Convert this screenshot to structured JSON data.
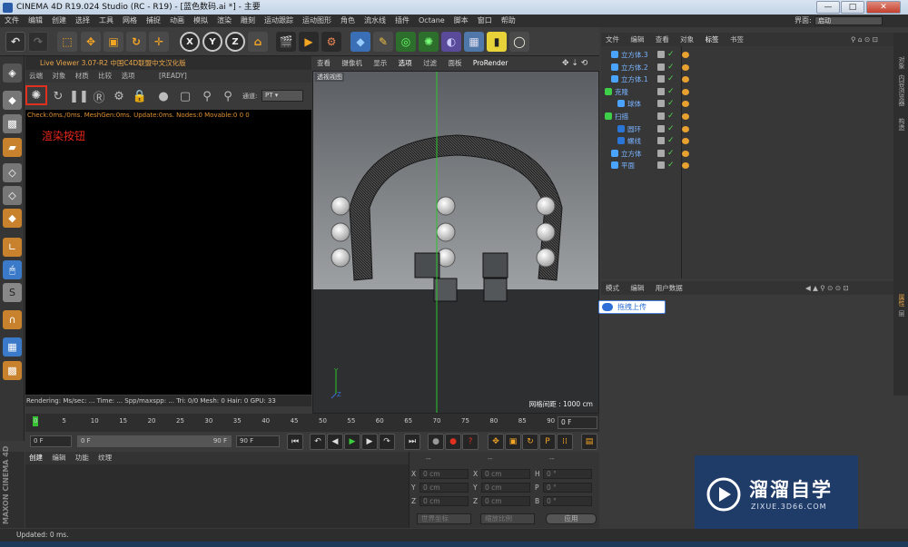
{
  "window": {
    "title": "CINEMA 4D R19.024 Studio (RC - R19) - [蓝色数码.ai *] - 主要",
    "min": "—",
    "max": "□",
    "close": "✕"
  },
  "menubar": {
    "items": [
      "文件",
      "编辑",
      "创建",
      "选择",
      "工具",
      "网格",
      "捕捉",
      "动画",
      "模拟",
      "渲染",
      "雕刻",
      "运动跟踪",
      "运动图形",
      "角色",
      "流水线",
      "插件",
      "Octane",
      "脚本",
      "窗口",
      "帮助"
    ],
    "layout_label": "界面:",
    "layout_value": "启动"
  },
  "toolbar": {
    "axis_x": "X",
    "axis_y": "Y",
    "axis_z": "Z"
  },
  "live_viewer": {
    "header": "Live Viewer 3.07-R2 中国C4D联盟中文汉化版",
    "menu": [
      "云端",
      "对象",
      "材质",
      "比较",
      "选项",
      "[READY]"
    ],
    "channel_label": "通道:",
    "channel_value": "PT",
    "status_line": "Check:0ms./0ms. MeshGen:0ms. Update:0ms. Nodes:0 Movable:0  0 0",
    "annotation": "渲染按钮",
    "footer": "Rendering:       Ms/sec: ...  Time: ...       Spp/maxspp: ...  Tri: 0/0  Mesh: 0     Hair: 0    GPU:   33"
  },
  "viewport": {
    "menu": [
      "查看",
      "摄像机",
      "显示",
      "选项",
      "过滤",
      "面板",
      "ProRender"
    ],
    "view_label": "透视视图",
    "grid_spacing": "网格间距 : 1000 cm",
    "axis_y": "Y",
    "axis_z": "Z"
  },
  "timeline": {
    "ticks": [
      "0",
      "5",
      "10",
      "15",
      "20",
      "25",
      "30",
      "35",
      "40",
      "45",
      "50",
      "55",
      "60",
      "65",
      "70",
      "75",
      "80",
      "85",
      "90"
    ],
    "frame_field": "0 F"
  },
  "transport": {
    "start": "0 F",
    "range_start": "0 F",
    "range_end": "90 F",
    "end": "90 F"
  },
  "material": {
    "menu": [
      "创建",
      "编辑",
      "功能",
      "纹理"
    ],
    "brand": "MAXON CINEMA 4D"
  },
  "coordinates": {
    "header": [
      "--",
      "--",
      "--"
    ],
    "rows": [
      {
        "a": "X",
        "av": "0 cm",
        "b": "X",
        "bv": "0 cm",
        "c": "H",
        "cv": "0 °"
      },
      {
        "a": "Y",
        "av": "0 cm",
        "b": "Y",
        "bv": "0 cm",
        "c": "P",
        "cv": "0 °"
      },
      {
        "a": "Z",
        "av": "0 cm",
        "b": "Z",
        "bv": "0 cm",
        "c": "B",
        "cv": "0 °"
      }
    ],
    "mode1": "世界坐标",
    "mode2": "缩放比例",
    "apply": "应用"
  },
  "object_manager": {
    "menu": [
      "文件",
      "编辑",
      "查看",
      "对象",
      "标签",
      "书签"
    ],
    "objects": [
      {
        "name": "立方体.3",
        "indent": 1,
        "icon_color": "#4aa3ff"
      },
      {
        "name": "立方体.2",
        "indent": 1,
        "icon_color": "#4aa3ff"
      },
      {
        "name": "立方体.1",
        "indent": 1,
        "icon_color": "#4aa3ff"
      },
      {
        "name": "克隆",
        "indent": 0,
        "icon_color": "#3fd04a"
      },
      {
        "name": "球体",
        "indent": 2,
        "icon_color": "#4aa3ff"
      },
      {
        "name": "扫描",
        "indent": 0,
        "icon_color": "#3fd04a"
      },
      {
        "name": "圆环",
        "indent": 2,
        "icon_color": "#2a76d8"
      },
      {
        "name": "螺线",
        "indent": 2,
        "icon_color": "#2a76d8"
      },
      {
        "name": "立方体",
        "indent": 1,
        "icon_color": "#4aa3ff"
      },
      {
        "name": "平面",
        "indent": 1,
        "icon_color": "#4aa3ff"
      }
    ]
  },
  "side_tabs": [
    "对象",
    "内容浏览器",
    "构造",
    "层"
  ],
  "attribute_manager": {
    "menu": [
      "模式",
      "编辑",
      "用户数据"
    ],
    "upload_button": "拖拽上传"
  },
  "attr_side_tabs": [
    "属性",
    "层"
  ],
  "watermark": {
    "brand": "溜溜自学",
    "url": "ZIXUE.3D66.COM"
  },
  "status": "Updated: 0 ms."
}
